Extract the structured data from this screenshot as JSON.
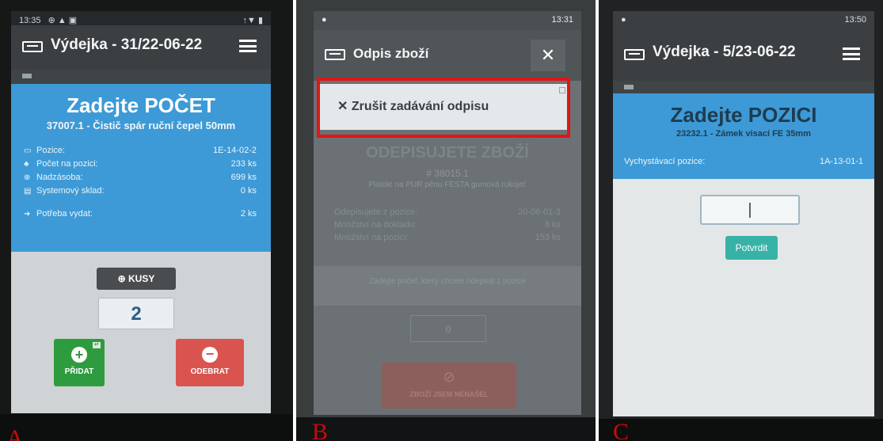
{
  "panelA": {
    "status_time": "13:35",
    "status_icons": "⊕ ▲ ▣",
    "status_right": "↑▼ ▮",
    "app_title": "Výdejka - 31/22-06-22",
    "heading": "Zadejte POČET",
    "item": "37007.1 - Čistič spár ruční čepel 50mm",
    "rows": [
      {
        "icon": "position-icon",
        "glyph": "▭",
        "label": "Pozice:",
        "value": "1E-14-02-2"
      },
      {
        "icon": "count-icon",
        "glyph": "♣",
        "label": "Počet na pozici:",
        "value": "233 ks"
      },
      {
        "icon": "surplus-icon",
        "glyph": "⊕",
        "label": "Nadzásoba:",
        "value": "699 ks"
      },
      {
        "icon": "warehouse-icon",
        "glyph": "▤",
        "label": "Systemový sklad:",
        "value": "0 ks"
      }
    ],
    "need_label": "Potřeba vydat:",
    "need_value": "2 ks",
    "unit_button": "KUSY",
    "quantity": "2",
    "add_label": "PŘIDAT",
    "remove_label": "ODEBRAT",
    "corner_label": "A"
  },
  "panelB": {
    "status_time": "13:31",
    "app_title": "Odpis zboží",
    "dropdown_item": "Zrušit zadávání odpisu",
    "bg_heading": "ODEPISUJETE ZBOŽÍ",
    "bg_code": "# 38015.1",
    "bg_item": "Pistole na PUR pěnu FESTA gumová rukojeť",
    "bg_rows": [
      {
        "label": "Odepisujete z pozice:",
        "value": "20-06-01-3"
      },
      {
        "label": "Množství na dokladu:",
        "value": "8 ks"
      },
      {
        "label": "Množství na pozici:",
        "value": "153 ks"
      }
    ],
    "bg_prompt": "Zadejte počet, který chcete odepsat z pozice",
    "bg_input": "0",
    "bg_button": "ZBOŽÍ JSEM NENAŠEL",
    "corner_label": "B"
  },
  "panelC": {
    "status_time": "13:50",
    "app_title": "Výdejka - 5/23-06-22",
    "heading": "Zadejte POZICI",
    "item": "23232.1 - Zámek visací FE 35mm",
    "position_label": "Vychystávací pozice:",
    "position_value": "1A-13-01-1",
    "input_value": "|",
    "confirm_label": "Potvrdit",
    "corner_label": "C"
  },
  "colors": {
    "header_blue": "#3d9ad6",
    "dark_bar": "#3b3f42",
    "add_green": "#2f9b3f",
    "remove_red": "#d9534f",
    "confirm_teal": "#38b2a7",
    "highlight_red": "#e01616"
  }
}
